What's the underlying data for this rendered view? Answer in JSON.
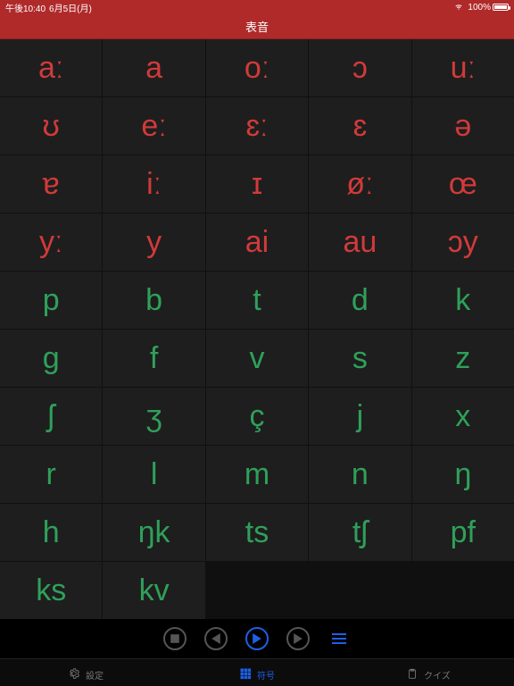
{
  "status": {
    "time": "午後10:40",
    "date": "6月5日(月)",
    "battery_pct": "100%"
  },
  "header": {
    "title": "表音"
  },
  "grid": {
    "cells": [
      {
        "sym": "aː",
        "cls": "vowel"
      },
      {
        "sym": "a",
        "cls": "vowel"
      },
      {
        "sym": "oː",
        "cls": "vowel"
      },
      {
        "sym": "ɔ",
        "cls": "vowel"
      },
      {
        "sym": "uː",
        "cls": "vowel"
      },
      {
        "sym": "ʊ",
        "cls": "vowel"
      },
      {
        "sym": "eː",
        "cls": "vowel"
      },
      {
        "sym": "ɛː",
        "cls": "vowel"
      },
      {
        "sym": "ɛ",
        "cls": "vowel"
      },
      {
        "sym": "ə",
        "cls": "vowel"
      },
      {
        "sym": "ɐ",
        "cls": "vowel"
      },
      {
        "sym": "iː",
        "cls": "vowel"
      },
      {
        "sym": "ɪ",
        "cls": "vowel"
      },
      {
        "sym": "øː",
        "cls": "vowel"
      },
      {
        "sym": "œ",
        "cls": "vowel"
      },
      {
        "sym": "yː",
        "cls": "vowel"
      },
      {
        "sym": "y",
        "cls": "vowel"
      },
      {
        "sym": "ai",
        "cls": "vowel"
      },
      {
        "sym": "au",
        "cls": "vowel"
      },
      {
        "sym": "ɔy",
        "cls": "vowel"
      },
      {
        "sym": "p",
        "cls": "consonant"
      },
      {
        "sym": "b",
        "cls": "consonant"
      },
      {
        "sym": "t",
        "cls": "consonant"
      },
      {
        "sym": "d",
        "cls": "consonant"
      },
      {
        "sym": "k",
        "cls": "consonant"
      },
      {
        "sym": "g",
        "cls": "consonant"
      },
      {
        "sym": "f",
        "cls": "consonant"
      },
      {
        "sym": "v",
        "cls": "consonant"
      },
      {
        "sym": "s",
        "cls": "consonant"
      },
      {
        "sym": "z",
        "cls": "consonant"
      },
      {
        "sym": "ʃ",
        "cls": "consonant"
      },
      {
        "sym": "ʒ",
        "cls": "consonant"
      },
      {
        "sym": "ç",
        "cls": "consonant"
      },
      {
        "sym": "j",
        "cls": "consonant"
      },
      {
        "sym": "x",
        "cls": "consonant"
      },
      {
        "sym": "r",
        "cls": "consonant"
      },
      {
        "sym": "l",
        "cls": "consonant"
      },
      {
        "sym": "m",
        "cls": "consonant"
      },
      {
        "sym": "n",
        "cls": "consonant"
      },
      {
        "sym": "ŋ",
        "cls": "consonant"
      },
      {
        "sym": "h",
        "cls": "consonant"
      },
      {
        "sym": "ŋk",
        "cls": "consonant"
      },
      {
        "sym": "ts",
        "cls": "consonant"
      },
      {
        "sym": "tʃ",
        "cls": "consonant"
      },
      {
        "sym": "pf",
        "cls": "consonant"
      },
      {
        "sym": "ks",
        "cls": "consonant"
      },
      {
        "sym": "kv",
        "cls": "consonant"
      },
      {
        "sym": "",
        "cls": "empty"
      },
      {
        "sym": "",
        "cls": "empty"
      },
      {
        "sym": "",
        "cls": "empty"
      }
    ]
  },
  "controls": {
    "stop": "stop",
    "prev": "prev",
    "play": "play",
    "next": "next",
    "menu": "menu"
  },
  "tabs": {
    "settings": {
      "label": "設定"
    },
    "symbols": {
      "label": "符号"
    },
    "quiz": {
      "label": "クイズ"
    }
  }
}
